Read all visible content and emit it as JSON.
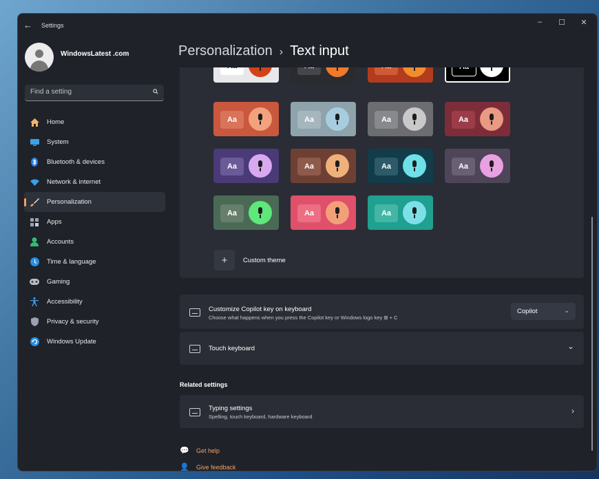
{
  "window": {
    "back_icon": "back-arrow-icon",
    "title": "Settings",
    "controls": {
      "minimize": "–",
      "maximize": "☐",
      "close": "✕"
    }
  },
  "profile": {
    "name": "WindowsLatest .com"
  },
  "search": {
    "placeholder": "Find a setting"
  },
  "nav": {
    "items": [
      {
        "label": "Home",
        "icon": "home-icon"
      },
      {
        "label": "System",
        "icon": "system-icon"
      },
      {
        "label": "Bluetooth & devices",
        "icon": "bluetooth-icon"
      },
      {
        "label": "Network & internet",
        "icon": "network-icon"
      },
      {
        "label": "Personalization",
        "icon": "brush-icon",
        "active": true
      },
      {
        "label": "Apps",
        "icon": "apps-icon"
      },
      {
        "label": "Accounts",
        "icon": "accounts-icon"
      },
      {
        "label": "Time & language",
        "icon": "time-language-icon"
      },
      {
        "label": "Gaming",
        "icon": "gaming-icon"
      },
      {
        "label": "Accessibility",
        "icon": "accessibility-icon"
      },
      {
        "label": "Privacy & security",
        "icon": "shield-icon"
      },
      {
        "label": "Windows Update",
        "icon": "update-icon"
      }
    ]
  },
  "breadcrumb": {
    "parent": "Personalization",
    "separator": "›",
    "current": "Text input"
  },
  "themes": {
    "aa_label": "Aa",
    "tiles": [
      {
        "bg": "#e8e8ea",
        "aa_bg": "#ffffff",
        "aa_fg": "#111111",
        "mic": "#d2421a"
      },
      {
        "bg": "#2a2b2e",
        "aa_bg": "#45464b",
        "aa_fg": "#ffffff",
        "mic": "#f07a2a"
      },
      {
        "bg": "#b23c1d",
        "aa_bg": "#cf5a38",
        "aa_fg": "#ffffff",
        "mic": "#f28c2c"
      },
      {
        "bg": "#000000",
        "aa_bg": "#000000",
        "aa_fg": "#ffffff",
        "mic": "#ffffff"
      },
      {
        "bg": "#c9583f",
        "aa_bg": "#d9735a",
        "aa_fg": "#ffffff",
        "mic": "#f2a27c"
      },
      {
        "bg": "#8fa3ad",
        "aa_bg": "#a5b6bf",
        "aa_fg": "#ffffff",
        "mic": "#a9cde0"
      },
      {
        "bg": "#6c6d70",
        "aa_bg": "#88898c",
        "aa_fg": "#ffffff",
        "mic": "#c9c9c9"
      },
      {
        "bg": "#7d2d3a",
        "aa_bg": "#9b3c48",
        "aa_fg": "#ffffff",
        "mic": "#e99a82"
      },
      {
        "bg": "#4a3a78",
        "aa_bg": "#6a5a98",
        "aa_fg": "#ffffff",
        "mic": "#d8a8f0"
      },
      {
        "bg": "#6e4034",
        "aa_bg": "#8e5a4a",
        "aa_fg": "#ffffff",
        "mic": "#f0b07a"
      },
      {
        "bg": "#133c4a",
        "aa_bg": "#2c5a68",
        "aa_fg": "#ffffff",
        "mic": "#6ee0e8"
      },
      {
        "bg": "#4e4558",
        "aa_bg": "#6a6074",
        "aa_fg": "#ffffff",
        "mic": "#e8a0e0"
      },
      {
        "bg": "#4a6a55",
        "aa_bg": "#667f6c",
        "aa_fg": "#ffffff",
        "mic": "#5ee87a"
      },
      {
        "bg": "#e0506a",
        "aa_bg": "#ec6e82",
        "aa_fg": "#ffffff",
        "mic": "#f2a07a"
      },
      {
        "bg": "#20a090",
        "aa_bg": "#44b6a6",
        "aa_fg": "#ffffff",
        "mic": "#7de0e8"
      }
    ],
    "custom_label": "Custom theme",
    "custom_icon": "plus-icon"
  },
  "copilot_row": {
    "icon": "keyboard-icon",
    "title": "Customize Copilot key on keyboard",
    "desc": "Choose what happens when you press the Copilot key or Windows logo key ⊞ + C",
    "dropdown_value": "Copilot"
  },
  "touch_keyboard_row": {
    "icon": "keyboard-icon",
    "title": "Touch keyboard"
  },
  "related": {
    "title": "Related settings"
  },
  "typing_row": {
    "icon": "keyboard-icon",
    "title": "Typing settings",
    "desc": "Spelling, touch keyboard, hardware keyboard"
  },
  "help_links": [
    {
      "label": "Get help",
      "icon": "help-icon"
    },
    {
      "label": "Give feedback",
      "icon": "feedback-icon"
    }
  ],
  "colors": {
    "accent": "#f5a05a",
    "window_bg": "#1f2229",
    "card_bg": "#2a2d35"
  }
}
